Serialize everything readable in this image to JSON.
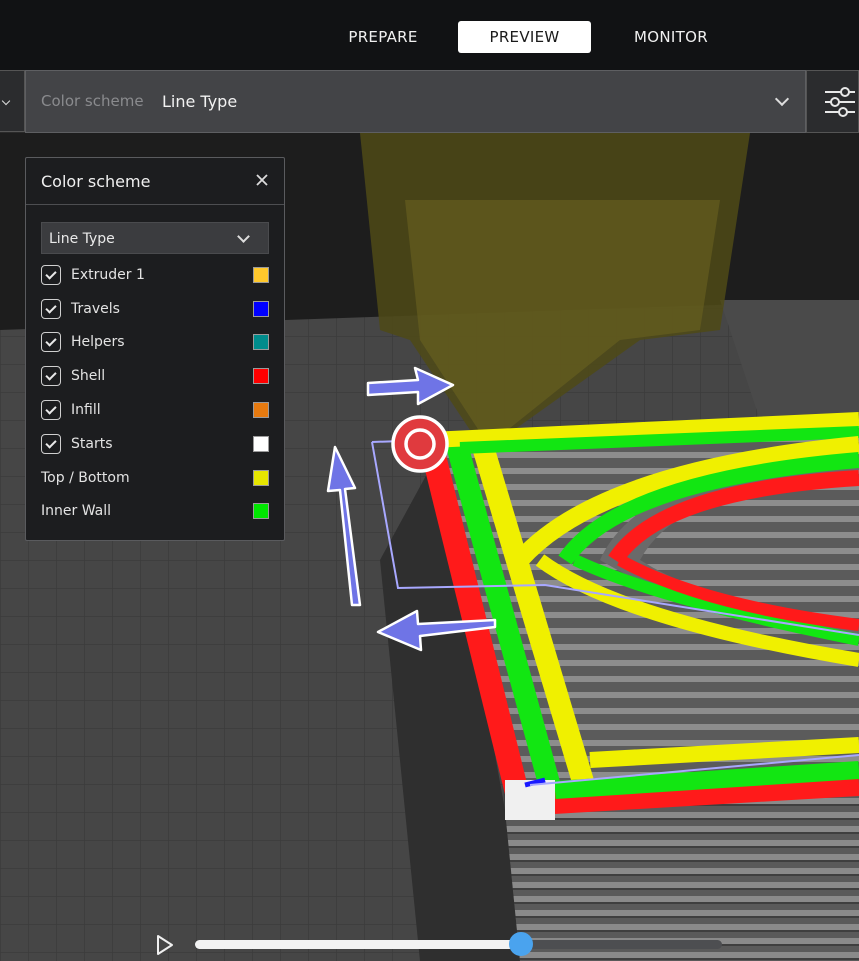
{
  "header": {
    "stages": [
      {
        "label": "PREPARE",
        "active": false
      },
      {
        "label": "PREVIEW",
        "active": true
      },
      {
        "label": "MONITOR",
        "active": false
      }
    ]
  },
  "toolbar": {
    "color_scheme_label": "Color scheme",
    "color_scheme_value": "Line Type",
    "settings_icon": "sliders-icon"
  },
  "panel": {
    "title": "Color scheme",
    "close_icon": "close-icon",
    "selected_scheme": "Line Type",
    "items": [
      {
        "label": "Extruder 1",
        "color": "#ffc82c",
        "checkbox": true
      },
      {
        "label": "Travels",
        "color": "#0000ff",
        "checkbox": true
      },
      {
        "label": "Helpers",
        "color": "#008c8c",
        "checkbox": true
      },
      {
        "label": "Shell",
        "color": "#ff0000",
        "checkbox": true
      },
      {
        "label": "Infill",
        "color": "#e67a10",
        "checkbox": true
      },
      {
        "label": "Starts",
        "color": "#ffffff",
        "checkbox": true
      },
      {
        "label": "Top / Bottom",
        "color": "#e6e600",
        "checkbox": false
      },
      {
        "label": "Inner Wall",
        "color": "#00e600",
        "checkbox": false
      }
    ]
  },
  "simulation": {
    "play_icon": "play-icon",
    "progress": 0.619
  },
  "colors": {
    "slider_thumb": "#4aa3ee",
    "annotation_arrow": "#6f74e6",
    "annotation_circle": "#e03a3e"
  }
}
